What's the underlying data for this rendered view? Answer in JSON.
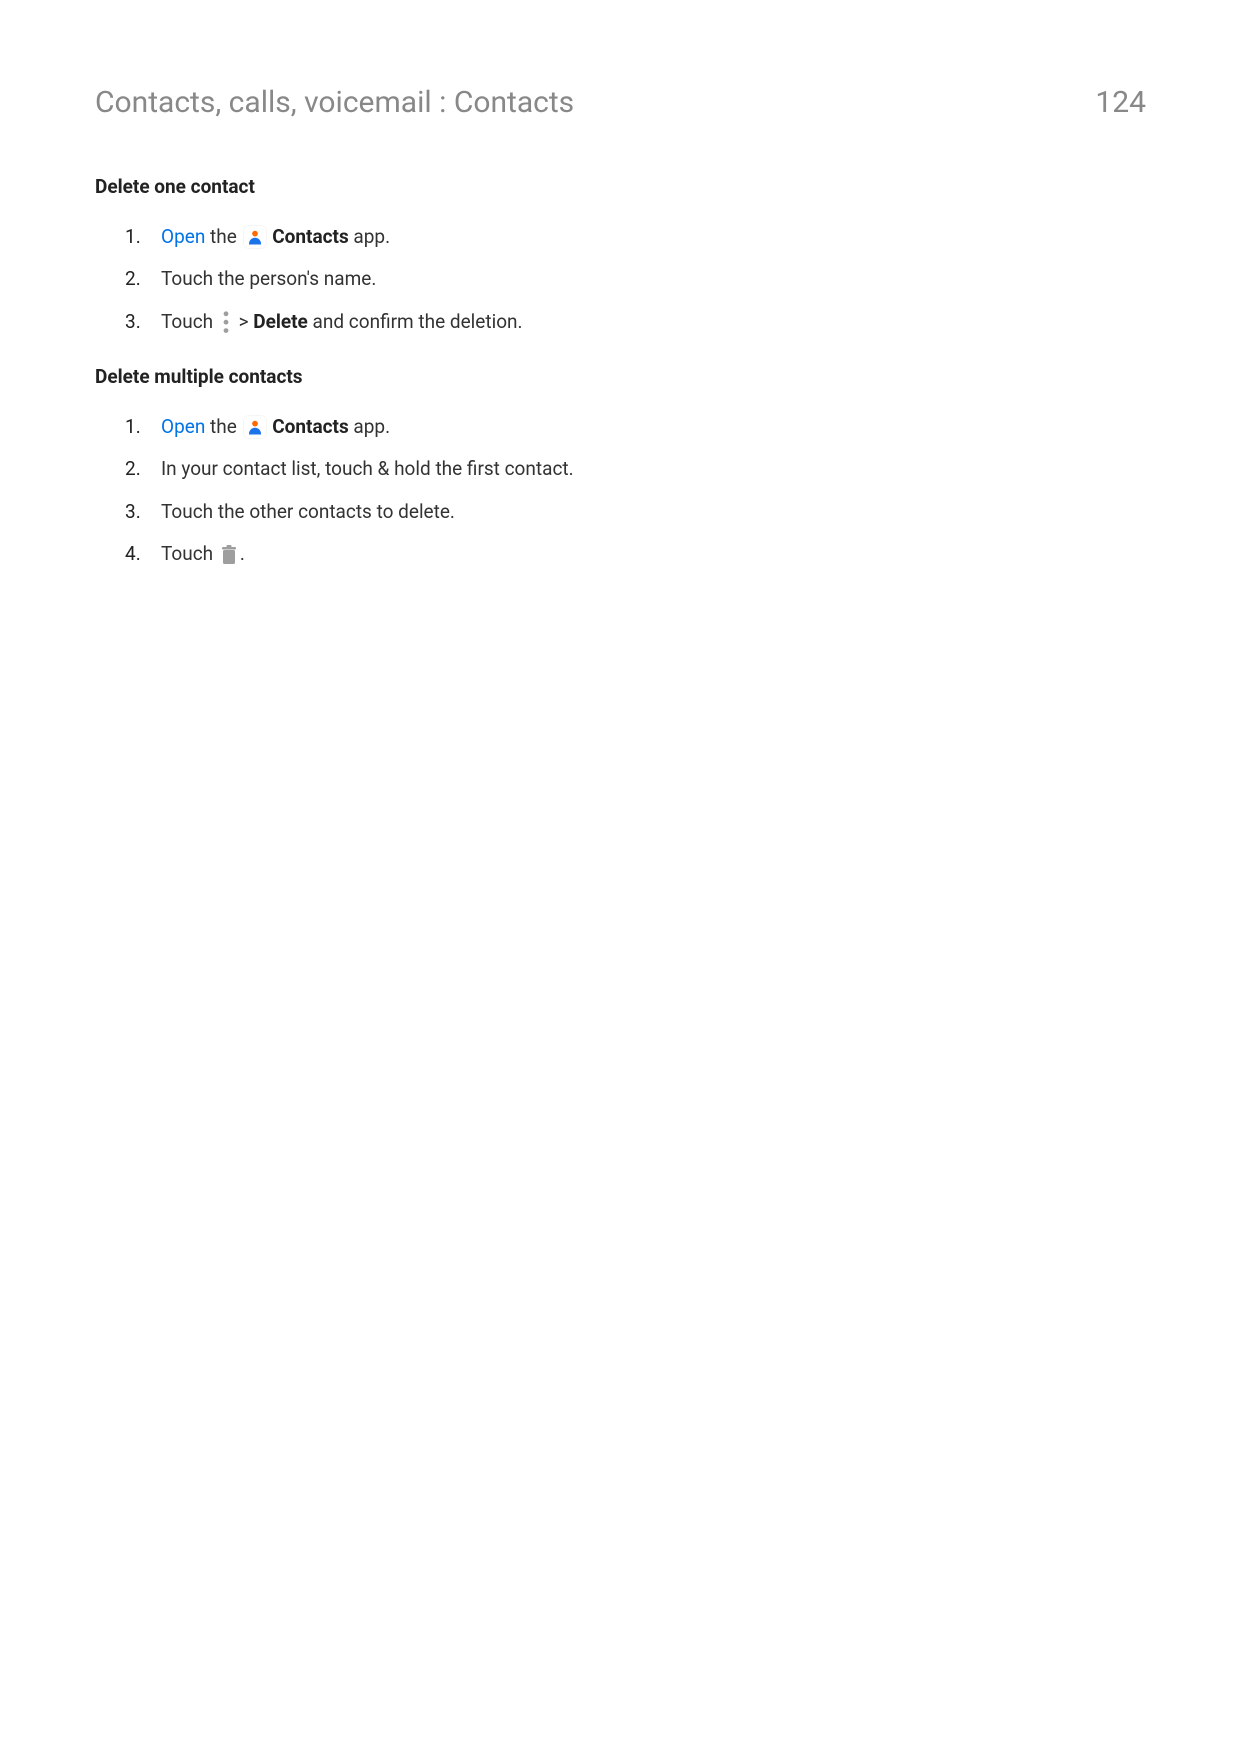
{
  "header": {
    "breadcrumb": "Contacts, calls, voicemail : Contacts",
    "page_number": "124"
  },
  "section1": {
    "heading": "Delete one contact",
    "steps": {
      "s1_open": "Open",
      "s1_the": " the ",
      "s1_contacts": "Contacts",
      "s1_app": " app.",
      "s2": "Touch the person's name.",
      "s3_touch": "Touch ",
      "s3_gt": " > ",
      "s3_delete": "Delete",
      "s3_rest": " and confirm the deletion."
    }
  },
  "section2": {
    "heading": "Delete multiple contacts",
    "steps": {
      "s1_open": "Open",
      "s1_the": " the ",
      "s1_contacts": "Contacts",
      "s1_app": " app.",
      "s2": "In your contact list, touch & hold the first contact.",
      "s3": "Touch the other contacts to delete.",
      "s4_touch": "Touch ",
      "s4_period": "."
    }
  }
}
